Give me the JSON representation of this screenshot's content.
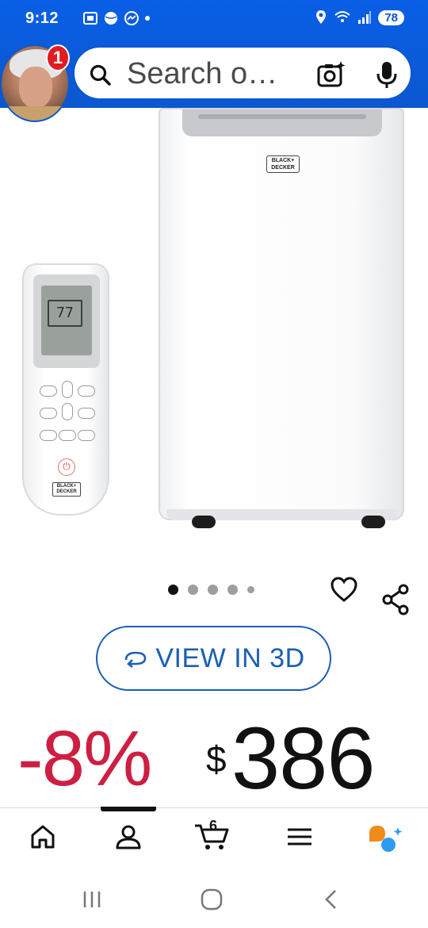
{
  "status_bar": {
    "time": "9:12",
    "battery": "78"
  },
  "header": {
    "notification_count": "1",
    "search": {
      "placeholder": "Search o…"
    }
  },
  "product_image": {
    "ac_brand_text": "BLACK+ DECKER",
    "remote_brand_text": "BLACK+ DECKER",
    "remote_display": "77",
    "carousel": {
      "count": 5,
      "active_index": 0
    }
  },
  "view_in_3d": {
    "label": "VIEW IN 3D"
  },
  "price": {
    "discount": "-8%",
    "currency": "$",
    "amount": "386"
  },
  "bottom_nav": {
    "cart_count": "6",
    "items": [
      "home-icon",
      "account-icon",
      "cart-icon",
      "menu-icon",
      "rufus-icon"
    ]
  },
  "colors": {
    "header_blue": "#0b57d0",
    "discount_red": "#cc1f42",
    "link_blue": "#1a5fb4"
  }
}
